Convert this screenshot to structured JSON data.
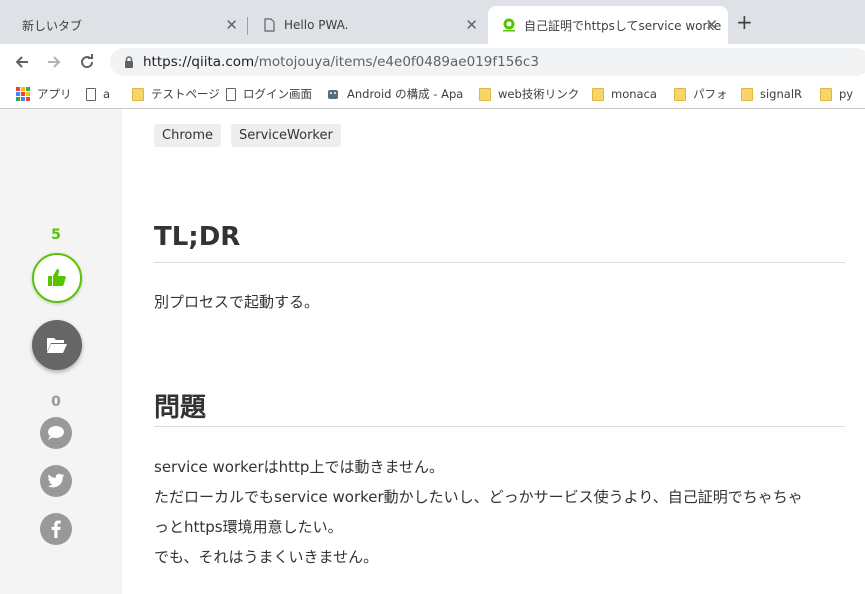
{
  "browser": {
    "tabs": [
      {
        "title": "新しいタブ",
        "active": false
      },
      {
        "title": "Hello PWA.",
        "active": false
      },
      {
        "title": "自己証明でhttpsしてservice worke",
        "active": true
      }
    ],
    "close_glyph": "✕",
    "new_tab_glyph": "+",
    "url_host": "https://qiita.com",
    "url_path": "/motojouya/items/e4e0f0489ae019f156c3",
    "bookmarks": [
      {
        "label": "アプリ",
        "icon": "apps-grid-icon"
      },
      {
        "label": "a",
        "icon": "page-icon"
      },
      {
        "label": "テストページ",
        "icon": "folder-icon"
      },
      {
        "label": "ログイン画面",
        "icon": "page-icon"
      },
      {
        "label": "Android の構成 - Apa",
        "icon": "android-icon"
      },
      {
        "label": "web技術リンク",
        "icon": "folder-icon"
      },
      {
        "label": "monaca",
        "icon": "folder-icon"
      },
      {
        "label": "パフォ",
        "icon": "folder-icon"
      },
      {
        "label": "signalR",
        "icon": "folder-icon"
      },
      {
        "label": "py",
        "icon": "folder-icon"
      }
    ]
  },
  "sidebar": {
    "like_count": "5",
    "comment_count": "0",
    "like_color": "#55c500"
  },
  "article": {
    "tags": [
      "Chrome",
      "ServiceWorker"
    ],
    "section1": {
      "heading": "TL;DR",
      "body": "別プロセスで起動する。"
    },
    "section2": {
      "heading": "問題",
      "lines": [
        "service workerはhttp上では動きません。",
        "ただローカルでもservice worker動かしたいし、どっかサービス使うより、自己証明でちゃちゃ",
        "っとhttps環境用意したい。",
        "でも、それはうまくいきません。"
      ]
    }
  }
}
